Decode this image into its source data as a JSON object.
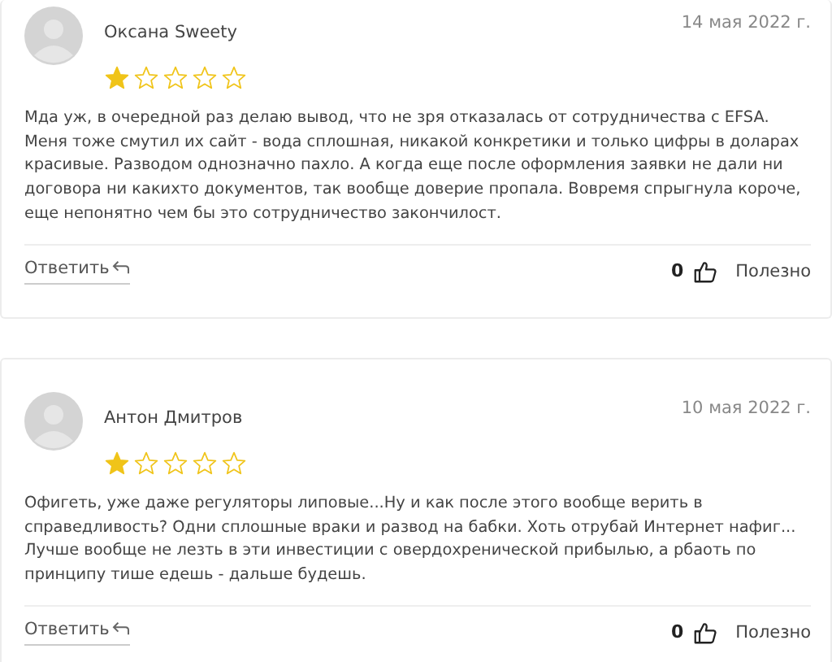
{
  "reviews": [
    {
      "author": "Оксана Sweety",
      "date": "14 мая 2022 г.",
      "stars": 1,
      "text": "Мда уж, в очередной раз делаю вывод, что не зря отказалась от сотрудничества с EFSA. Меня тоже смутил их сайт - вода сплошная, никакой конкретики и только цифры в доларах красивые. Разводом однозначно пахло. А когда еще после оформления заявки не дали ни договора ни какихто документов, так вообще доверие пропала. Вовремя спрыгнула короче, еще непонятно чем бы это сотрудничество закончилост.",
      "reply": "Ответить",
      "likes": "0",
      "helpful": "Полезно"
    },
    {
      "author": "Антон Дмитров",
      "date": "10 мая 2022 г.",
      "stars": 1,
      "text": "Офигеть, уже даже регуляторы липовые...Ну и как после этого вообще верить в справедливость? Одни сплошные враки и развод на бабки. Хоть отрубай Интернет нафиг... Лучше вообще не лезть в эти инвестиции с овердохренической прибылью, а рбаоть по принципу тише едешь - дальше будешь.",
      "reply": "Ответить",
      "likes": "0",
      "helpful": "Полезно"
    }
  ]
}
